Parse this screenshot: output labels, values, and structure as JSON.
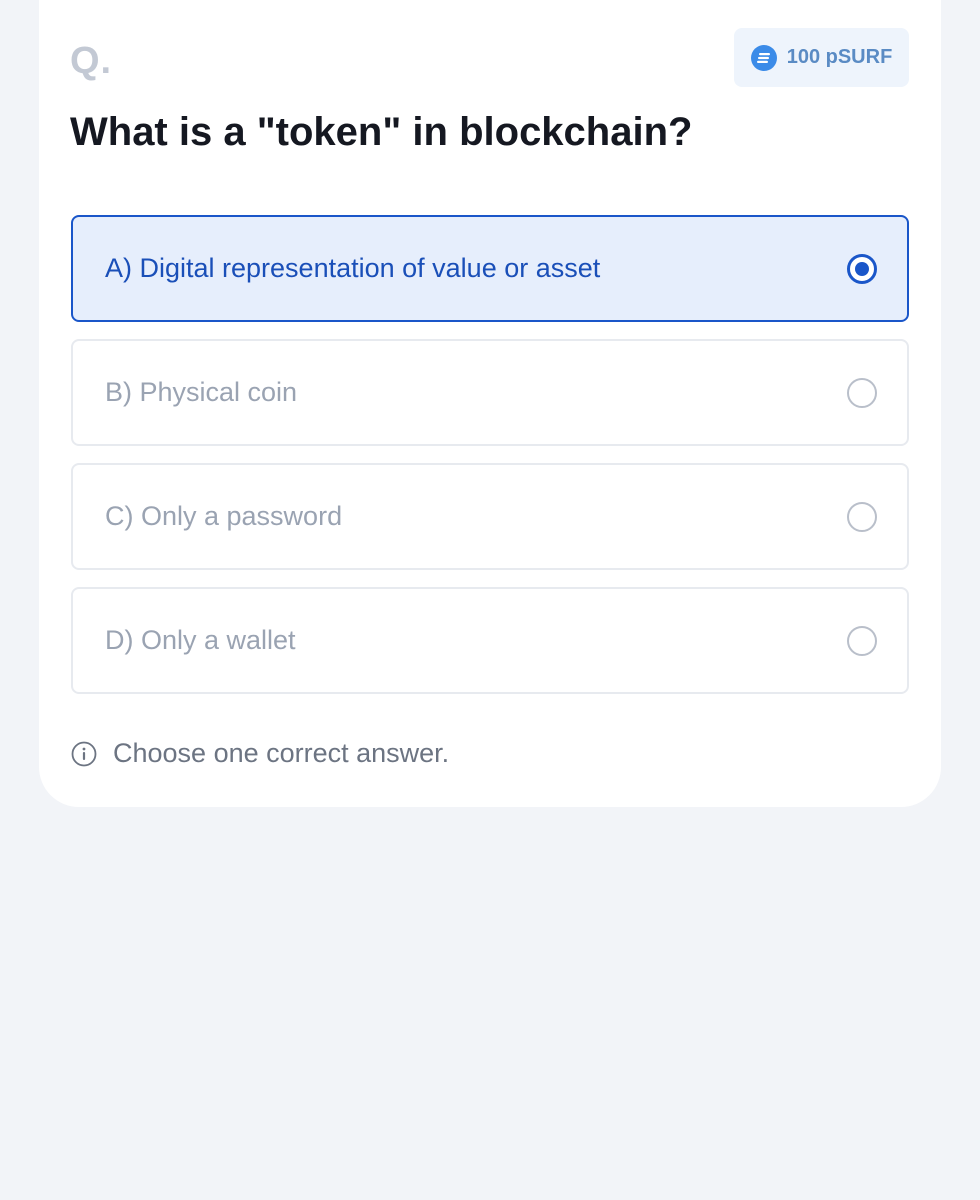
{
  "question": {
    "marker": "Q.",
    "text": "What is a \"token\" in blockchain?"
  },
  "reward": {
    "label": "100 pSURF",
    "icon": "coin-icon",
    "color": "#3b8be8"
  },
  "options": [
    {
      "label": "A) Digital representation of value or asset",
      "selected": true
    },
    {
      "label": "B) Physical coin",
      "selected": false
    },
    {
      "label": "C) Only a password",
      "selected": false
    },
    {
      "label": "D) Only a wallet",
      "selected": false
    }
  ],
  "hint": {
    "icon": "info-icon",
    "text": "Choose one correct answer."
  },
  "colors": {
    "accent": "#1a56c9",
    "selected_background": "#e6eefc",
    "page_background": "#f2f4f8"
  }
}
